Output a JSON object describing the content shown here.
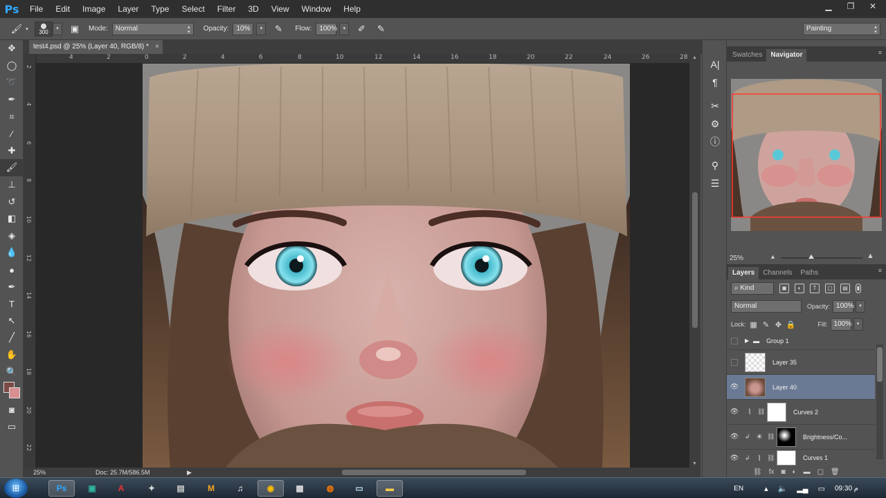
{
  "app": {
    "logo": "Ps"
  },
  "menu": [
    "File",
    "Edit",
    "Image",
    "Layer",
    "Type",
    "Select",
    "Filter",
    "3D",
    "View",
    "Window",
    "Help"
  ],
  "window_controls": {
    "minimize": "▁",
    "restore": "❐",
    "close": "✕"
  },
  "options_bar": {
    "brush_size": "300",
    "mode_label": "Mode:",
    "mode_value": "Normal",
    "opacity_label": "Opacity:",
    "opacity_value": "10%",
    "flow_label": "Flow:",
    "flow_value": "100%",
    "workspace_value": "Painting"
  },
  "document": {
    "tab_title": "test4.psd @ 25% (Layer 40, RGB/8) *",
    "tab_close": "×",
    "ruler_h_ticks": [
      "4",
      "2",
      "0",
      "2",
      "4",
      "6",
      "8",
      "10",
      "12",
      "14",
      "16",
      "18",
      "20",
      "22",
      "24",
      "26",
      "28"
    ],
    "ruler_v_ticks": [
      "2",
      "4",
      "6",
      "8",
      "10",
      "12",
      "14",
      "16",
      "18",
      "20",
      "22"
    ],
    "status_zoom": "25%",
    "status_doc": "Doc: 25.7M/586.5M"
  },
  "navigator": {
    "tabs": [
      "Swatches",
      "Navigator"
    ],
    "active_tab": "Navigator",
    "zoom": "25%"
  },
  "layers": {
    "tabs": [
      "Layers",
      "Channels",
      "Paths"
    ],
    "active_tab": "Layers",
    "filter_value": "Kind",
    "blend_mode": "Normal",
    "opacity_label": "Opacity:",
    "opacity_value": "100%",
    "lock_label": "Lock:",
    "fill_label": "Fill:",
    "fill_value": "100%",
    "items": [
      {
        "name": "Group 1",
        "visible": false,
        "type": "group"
      },
      {
        "name": "Layer 35",
        "visible": false,
        "type": "transparent"
      },
      {
        "name": "Layer 40",
        "visible": true,
        "type": "image",
        "selected": true
      },
      {
        "name": "Curves 2",
        "visible": true,
        "type": "adjustment-curves"
      },
      {
        "name": "Brightness/Co...",
        "visible": true,
        "type": "adjustment-brightness"
      },
      {
        "name": "Curves 1",
        "visible": true,
        "type": "adjustment-curves"
      }
    ]
  },
  "taskbar": {
    "apps": [
      "Ps",
      "",
      "A",
      "",
      "",
      "M",
      "",
      "",
      "",
      "",
      "",
      ""
    ],
    "language": "EN",
    "clock": "09:30 م"
  },
  "colors": {
    "foreground": "#7b4a45",
    "background": "#d98f92",
    "selection": "#6b7a94",
    "navigator_frame": "#ff3b30"
  }
}
